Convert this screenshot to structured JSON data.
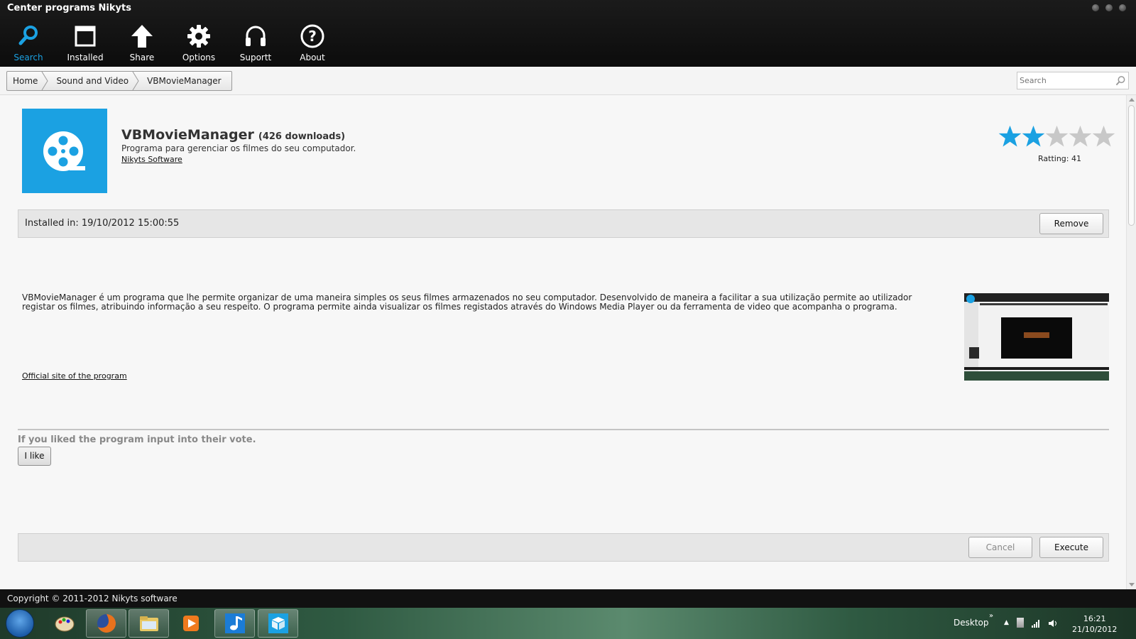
{
  "window": {
    "title": "Center programs Nikyts"
  },
  "toolbar": {
    "items": [
      {
        "label": "Search",
        "icon": "search-icon",
        "active": true
      },
      {
        "label": "Installed",
        "icon": "window-icon",
        "active": false
      },
      {
        "label": "Share",
        "icon": "upload-arrow-icon",
        "active": false
      },
      {
        "label": "Options",
        "icon": "gear-icon",
        "active": false
      },
      {
        "label": "Suportt",
        "icon": "headphones-icon",
        "active": false
      },
      {
        "label": "About",
        "icon": "question-icon",
        "active": false
      }
    ]
  },
  "breadcrumb": [
    "Home",
    "Sound and Video",
    "VBMovieManager"
  ],
  "search": {
    "placeholder": "Search"
  },
  "app": {
    "name": "VBMovieManager",
    "downloads": "(426 downloads)",
    "description": "Programa para gerenciar os filmes do seu computador.",
    "vendor": "Nikyts Software",
    "rating_label": "Ratting: 41",
    "stars_filled": 2,
    "stars_total": 5
  },
  "install": {
    "text": "Installed in: 19/10/2012 15:00:55",
    "remove_label": "Remove"
  },
  "details": {
    "description": "VBMovieManager é um programa que lhe permite organizar de uma maneira simples os seus filmes armazenados no seu computador. Desenvolvido de maneira a facilitar a sua utilização permite ao utilizador registar os filmes, atribuindo informação a seu respeito. O programa permite ainda visualizar os filmes registados através do Windows Media Player ou da ferramenta de video que acompanha o programa.",
    "official_link": "Official site of the program"
  },
  "vote": {
    "title": "If you liked the program input into their vote.",
    "like_label": "I like"
  },
  "actions": {
    "cancel_label": "Cancel",
    "execute_label": "Execute"
  },
  "footer": {
    "copyright": "Copyright © 2011-2012 Nikyts software"
  },
  "taskbar": {
    "items": [
      "start-orb",
      "paint-icon",
      "firefox-icon",
      "folder-icon",
      "media-player-icon",
      "music-note-icon",
      "box-icon"
    ],
    "desktop_label": "Desktop",
    "chevron": "»",
    "time": "16:21",
    "date": "21/10/2012"
  },
  "colors": {
    "accent": "#1ba1e2",
    "star_empty": "#c8c8c8",
    "toolbar_bg": "#111111"
  }
}
